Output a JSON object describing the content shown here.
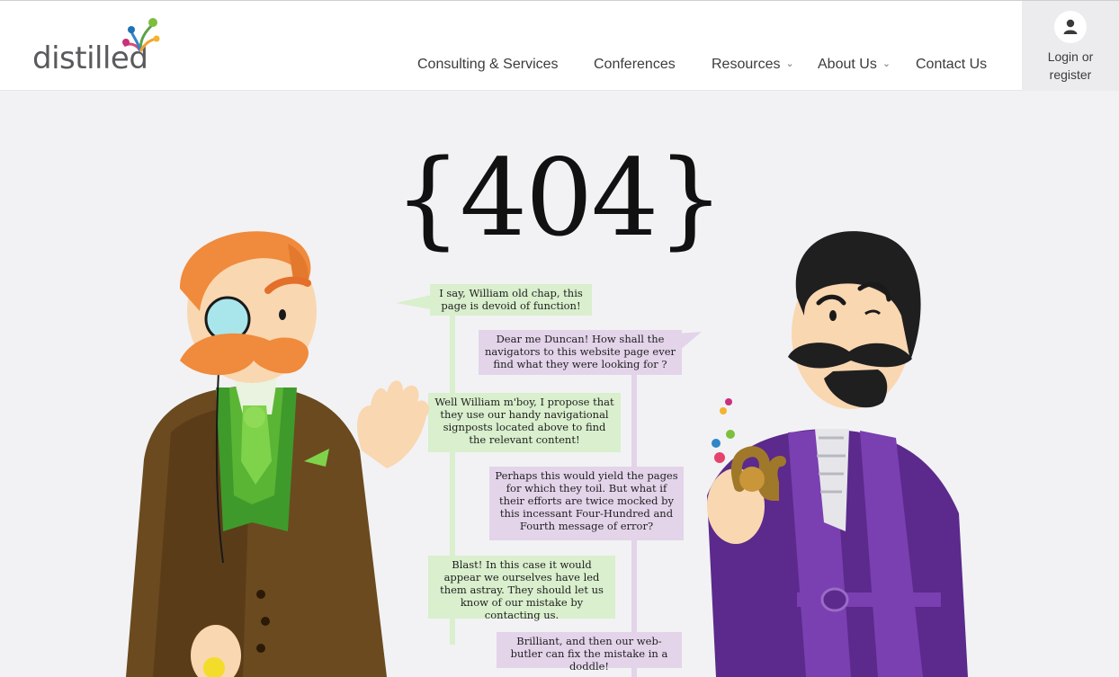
{
  "header": {
    "logo_text": "distilled",
    "nav": [
      {
        "label": "Consulting & Services",
        "has_dropdown": false
      },
      {
        "label": "Conferences",
        "has_dropdown": false
      },
      {
        "label": "Resources",
        "has_dropdown": true
      },
      {
        "label": "About Us",
        "has_dropdown": true
      },
      {
        "label": "Contact Us",
        "has_dropdown": false
      }
    ],
    "login_line1": "Login or",
    "login_line2": "register",
    "login_icon": "user-icon"
  },
  "main": {
    "error_code": "{404}",
    "dialogue": [
      {
        "speaker": "william",
        "text": "I say, William old chap, this page is devoid of function!"
      },
      {
        "speaker": "duncan",
        "text": "Dear me Duncan! How shall the navigators to this website page ever find what they were looking for ?"
      },
      {
        "speaker": "william",
        "text": "Well William m'boy, I propose that they use our handy navigational signposts located above to find the relevant content!"
      },
      {
        "speaker": "duncan",
        "text": "Perhaps this would yield the pages for which they toil. But what if their efforts are twice  mocked by this incessant Four-Hundred and Fourth message of error?"
      },
      {
        "speaker": "william",
        "text": "Blast! In this case it would appear we ourselves have led them astray. They should let us know of our mistake by contacting us."
      },
      {
        "speaker": "duncan",
        "text": "Brilliant, and then our web-butler can fix the mistake in a doddle!"
      }
    ]
  },
  "colors": {
    "bubble_green": "#d9efcd",
    "bubble_purple": "#e3d4ea",
    "background": "#f2f2f4",
    "robe_purple": "#5b2a8c",
    "coat_brown": "#6b4a1f",
    "hair_orange": "#f08a3c"
  }
}
